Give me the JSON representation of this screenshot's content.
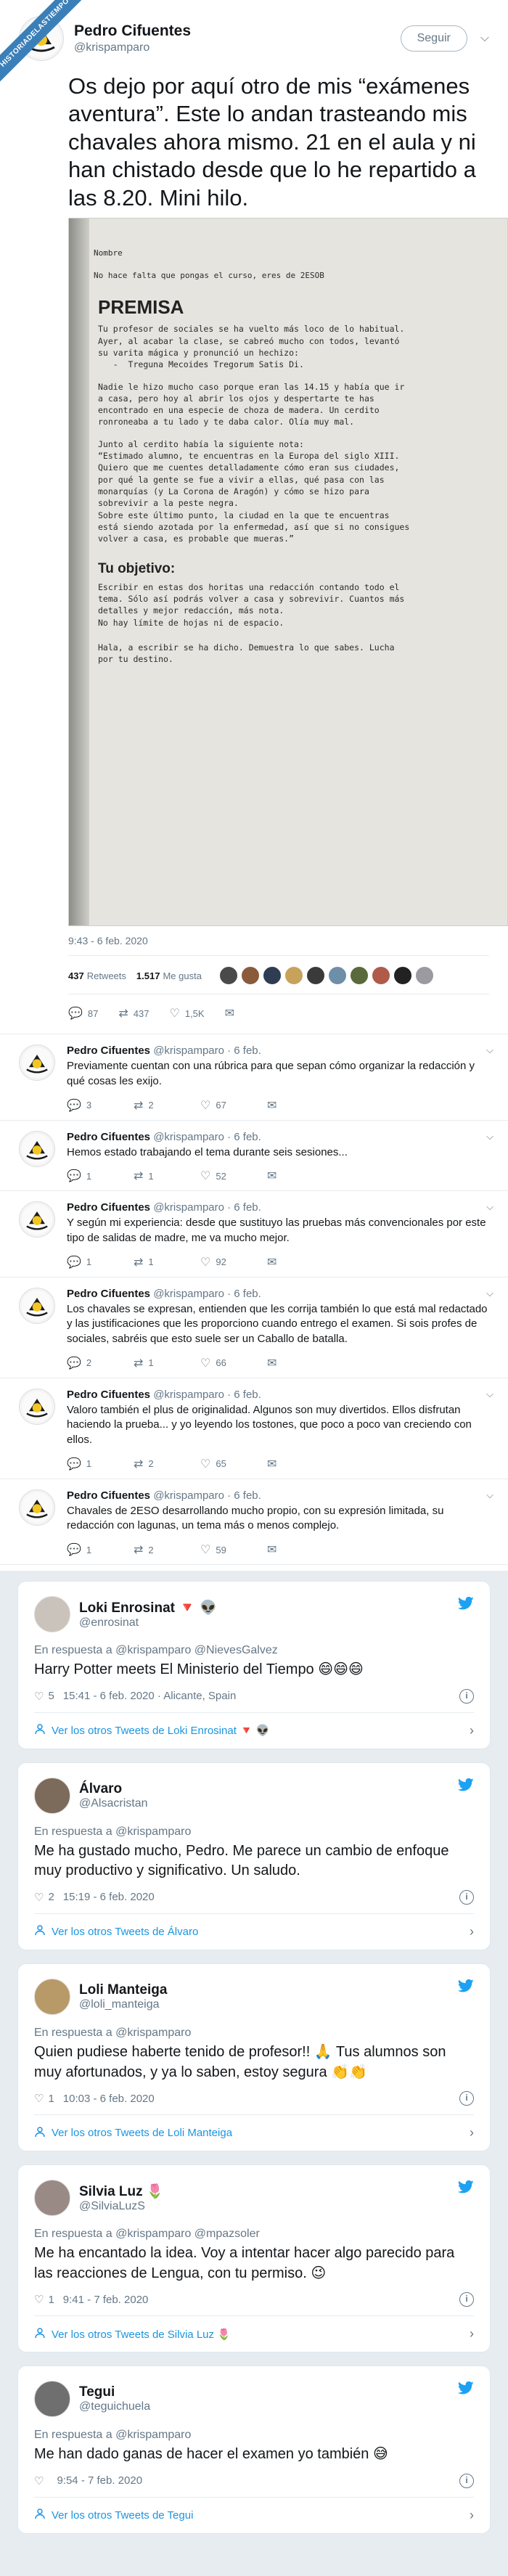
{
  "corner_label": "HISTORIADELASTIEMPOS",
  "main": {
    "name": "Pedro Cifuentes",
    "handle": "@krispamparo",
    "follow_label": "Seguir",
    "chevron": "⌵",
    "text": "Os dejo por aquí otro de mis “exámenes aventura”. Este lo andan trasteando mis chavales ahora mismo. 21 en el aula y ni han chistado desde que lo he repartido a las 8.20. Mini hilo.",
    "photo": {
      "nombre": "Nombre",
      "curso": "No hace falta que pongas el curso, eres de 2ESOB",
      "premisa": "PREMISA",
      "p1": "Tu profesor de sociales se ha vuelto más loco de lo habitual.\nAyer, al acabar la clase, se cabreó mucho con todos, levantó\nsu varita mágica y pronunció un hechizo:\n   -  Treguna Mecoides Tregorum Satis Di.",
      "p2": "Nadie le hizo mucho caso porque eran las 14.15 y había que ir\na casa, pero hoy al abrir los ojos y despertarte te has\nencontrado en una especie de choza de madera. Un cerdito\nronroneaba a tu lado y te daba calor. Olía muy mal.",
      "p3": "Junto al cerdito había la siguiente nota:\n“Estimado alumno, te encuentras en la Europa del siglo XIII.\nQuiero que me cuentes detalladamente cómo eran sus ciudades,\npor qué la gente se fue a vivir a ellas, qué pasa con las\nmonarquías (y La Corona de Aragón) y cómo se hizo para\nsobrevivir a la peste negra.\nSobre este último punto, la ciudad en la que te encuentras\nestá siendo azotada por la enfermedad, así que si no consigues\nvolver a casa, es probable que mueras.”",
      "objetivo": "Tu objetivo:",
      "p4": "Escribir en estas dos horitas una redacción contando todo el\ntema. Sólo así podrás volver a casa y sobrevivir. Cuantos más\ndetalles y mejor redacción, más nota.\nNo hay límite de hojas ni de espacio.",
      "p5": "Hala, a escribir se ha dicho. Demuestra lo que sabes. Lucha\npor tu destino."
    },
    "time": "9:43 - 6 feb. 2020",
    "retweets_count": "437",
    "retweets_label": "Retweets",
    "likes_count": "1.517",
    "likes_label": "Me gusta",
    "actions": {
      "reply": "87",
      "retweet": "437",
      "like": "1,5K"
    }
  },
  "thread": [
    {
      "name": "Pedro Cifuentes",
      "meta": "@krispamparo · 6 feb.",
      "text": "Previamente cuentan con una rúbrica para que sepan cómo organizar la redacción y qué cosas les exijo.",
      "reply": "3",
      "retweet": "2",
      "like": "67"
    },
    {
      "name": "Pedro Cifuentes",
      "meta": "@krispamparo · 6 feb.",
      "text": "Hemos estado trabajando el tema durante seis sesiones...",
      "reply": "1",
      "retweet": "1",
      "like": "52"
    },
    {
      "name": "Pedro Cifuentes",
      "meta": "@krispamparo · 6 feb.",
      "text": "Y según mi experiencia: desde que sustituyo las pruebas más convencionales por este tipo de salidas de madre, me va mucho mejor.",
      "reply": "1",
      "retweet": "1",
      "like": "92"
    },
    {
      "name": "Pedro Cifuentes",
      "meta": "@krispamparo · 6 feb.",
      "text": "Los chavales se expresan, entienden que les corrija también lo que está mal redactado y las justificaciones que les proporciono cuando entrego el examen. Si sois profes de sociales, sabréis que esto suele ser un Caballo de batalla.",
      "reply": "2",
      "retweet": "1",
      "like": "66"
    },
    {
      "name": "Pedro Cifuentes",
      "meta": "@krispamparo · 6 feb.",
      "text": "Valoro también el plus de originalidad. Algunos son muy divertidos. Ellos disfrutan haciendo la prueba... y yo leyendo los tostones, que poco a poco van creciendo con ellos.",
      "reply": "1",
      "retweet": "2",
      "like": "65"
    },
    {
      "name": "Pedro Cifuentes",
      "meta": "@krispamparo · 6 feb.",
      "text": "Chavales de 2ESO desarrollando mucho propio, con su expresión limitada, su redacción con lagunas, un tema más o menos complejo.",
      "reply": "1",
      "retweet": "2",
      "like": "59"
    }
  ],
  "cards": [
    {
      "name": "Loki Enrosinat 🔻 👽",
      "handle": "@enrosinat",
      "reply_to": "En respuesta a @krispamparo @NievesGalvez",
      "text": "Harry Potter meets El Ministerio del Tiempo 😄😄😄",
      "likes": "5",
      "meta": "15:41 - 6 feb. 2020 · Alicante, Spain",
      "link": "Ver los otros Tweets de Loki Enrosinat 🔻 👽",
      "avatar_color": "#c9c3bb"
    },
    {
      "name": "Álvaro ",
      "handle": "@Alsacristan",
      "reply_to": "En respuesta a @krispamparo",
      "text": "Me ha gustado mucho, Pedro. Me parece un cambio de enfoque muy productivo y significativo. Un saludo.",
      "likes": "2",
      "meta": "15:19 - 6 feb. 2020",
      "link": "Ver los otros Tweets de Álvaro ",
      "avatar_color": "#7c6a5a"
    },
    {
      "name": "Loli Manteiga",
      "handle": "@loli_manteiga",
      "reply_to": "En respuesta a @krispamparo",
      "text": "Quien pudiese haberte tenido de profesor!! 🙏 Tus alumnos son muy afortunados, y ya lo saben, estoy segura 👏👏",
      "likes": "1",
      "meta": "10:03 - 6 feb. 2020",
      "link": "Ver los otros Tweets de Loli Manteiga",
      "avatar_color": "#b89a68"
    },
    {
      "name": "Silvia Luz 🌷",
      "handle": "@SilviaLuzS",
      "reply_to": "En respuesta a @krispamparo @mpazsoler",
      "text": "Me ha encantado la idea. Voy a intentar hacer algo parecido para las reacciones de Lengua, con tu permiso. 😉",
      "likes": "1",
      "meta": "9:41 - 7 feb. 2020",
      "link": "Ver los otros Tweets de Silvia Luz 🌷",
      "avatar_color": "#9a8a86"
    },
    {
      "name": "Tegui",
      "handle": "@teguichuela",
      "reply_to": "En respuesta a @krispamparo",
      "text": "Me han dado ganas de hacer el examen yo también 😅",
      "likes": "",
      "meta": "9:54 - 7 feb. 2020",
      "link": "Ver los otros Tweets de Tegui",
      "avatar_color": "#6f6f6f"
    }
  ],
  "icons": {
    "reply": "reply-icon",
    "retweet": "retweet-icon",
    "like": "heart-icon",
    "dm": "mail-icon",
    "twitter": "twitter-bird-icon",
    "info": "info-icon",
    "person": "person-icon"
  },
  "colors": {
    "link": "#1b95e0",
    "muted": "#657786",
    "bird": "#1da1f2",
    "corner": "#3b7fb8"
  }
}
